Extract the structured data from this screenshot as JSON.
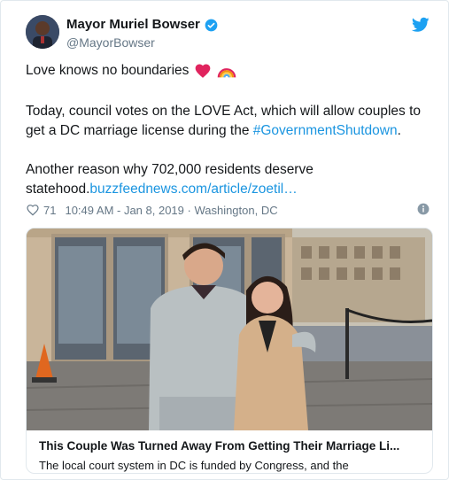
{
  "tweet": {
    "author_name": "Mayor Muriel Bowser",
    "author_handle": "@MayorBowser",
    "line1": "Love knows no boundaries",
    "para2_text": "Today, council votes on the LOVE Act, which will allow couples to get a DC marriage license during the ",
    "para2_hashtag": "#GovernmentShutdown",
    "para2_end": ".",
    "para3_text_a": "Another reason why 702,000 residents deserve statehood.",
    "para3_link": "buzzfeednews.com/article/zoetil…",
    "like_count": "71",
    "timestamp": "10:49 AM - Jan 8, 2019 · Washington, DC"
  },
  "card": {
    "title": "This Couple Was Turned Away From Getting Their Marriage Li...",
    "description": "The local court system in DC is funded by Congress, and the"
  },
  "icons": {
    "verified": "verified-badge-icon",
    "bird": "twitter-bird-icon",
    "heart": "heart-icon",
    "info": "info-icon",
    "emoji1": "red-heart-emoji",
    "emoji2": "rainbow-emoji"
  },
  "colors": {
    "link": "#1b95e0",
    "meta": "#657786",
    "heart_emoji": "#e0245e"
  }
}
